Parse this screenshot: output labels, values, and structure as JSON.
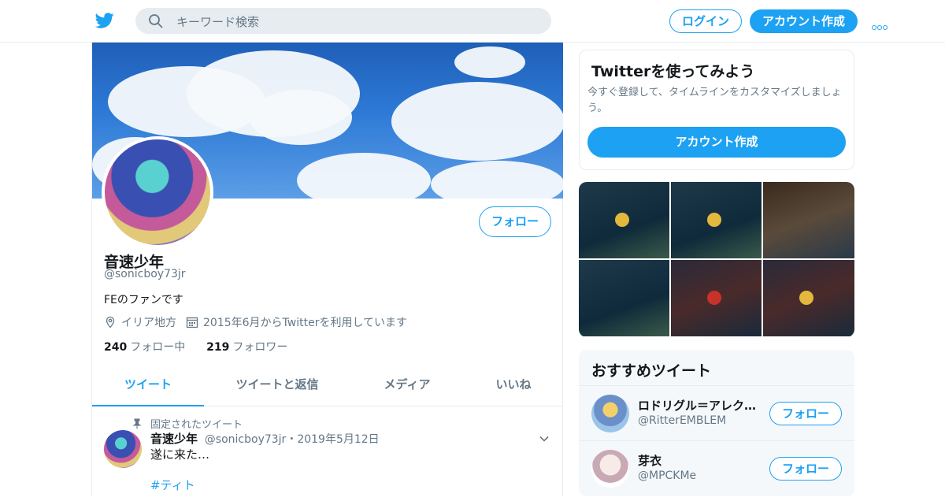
{
  "header": {
    "search_placeholder": "キーワード検索",
    "login_label": "ログイン",
    "signup_label": "アカウント作成",
    "brand_color": "#1da1f2"
  },
  "profile": {
    "name": "音速少年",
    "handle": "@sonicboy73jr",
    "bio": "FEのファンです",
    "location": "イリア地方",
    "joined": "2015年6月からTwitterを利用しています",
    "following_count": "240",
    "following_label": "フォロー中",
    "followers_count": "219",
    "followers_label": "フォロワー",
    "follow_label": "フォロー"
  },
  "tabs": [
    {
      "label": "ツイート",
      "active": true
    },
    {
      "label": "ツイートと返信",
      "active": false
    },
    {
      "label": "メディア",
      "active": false
    },
    {
      "label": "いいね",
      "active": false
    }
  ],
  "pinned_tweet": {
    "pinned_label": "固定されたツイート",
    "name": "音速少年",
    "handle": "@sonicboy73jr",
    "date": "2019年5月12日",
    "text": "遂に来た…",
    "hashtag": "#ティト"
  },
  "signup_card": {
    "title": "Twitterを使ってみよう",
    "description": "今すぐ登録して、タイムラインをカスタマイズしましょう。",
    "button_label": "アカウント作成"
  },
  "recommended": {
    "title": "おすすめツイート",
    "users": [
      {
        "name": "ロドリグル＝アレク…",
        "handle": "@RitterEMBLEM",
        "follow_label": "フォロー"
      },
      {
        "name": "芽衣",
        "handle": "@MPCKMe",
        "follow_label": "フォロー"
      }
    ]
  }
}
